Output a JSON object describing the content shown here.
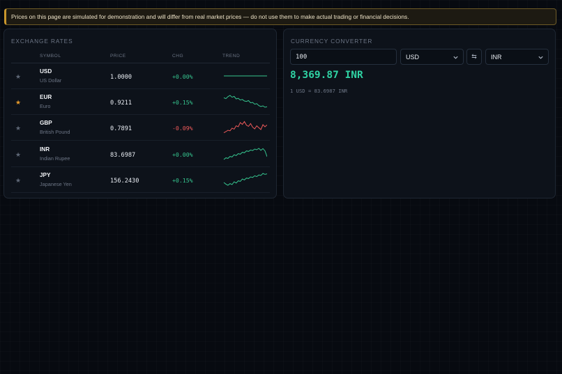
{
  "banner": {
    "text": "Prices on this page are simulated for demonstration and will differ from real market prices — do not use them to make actual trading or financial decisions."
  },
  "rates": {
    "title": "EXCHANGE RATES",
    "headers": {
      "symbol": "SYMBOL",
      "price": "PRICE",
      "chg": "CHG",
      "trend": "TREND"
    },
    "rows": [
      {
        "symbol": "USD",
        "name": "US Dollar",
        "price": "1.0000",
        "chg": "+0.00%",
        "dir": "up",
        "favorite": false,
        "trend": [
          0.5,
          0.5,
          0.5,
          0.5,
          0.5,
          0.5,
          0.5,
          0.5,
          0.5,
          0.5,
          0.5,
          0.5,
          0.5,
          0.5,
          0.5,
          0.5,
          0.5,
          0.5,
          0.5,
          0.5
        ]
      },
      {
        "symbol": "EUR",
        "name": "Euro",
        "price": "0.9211",
        "chg": "+0.15%",
        "dir": "up",
        "favorite": true,
        "trend": [
          0.78,
          0.72,
          0.86,
          0.95,
          0.82,
          0.88,
          0.7,
          0.74,
          0.62,
          0.66,
          0.55,
          0.52,
          0.58,
          0.42,
          0.45,
          0.32,
          0.36,
          0.22,
          0.15,
          0.2,
          0.1,
          0.14
        ]
      },
      {
        "symbol": "GBP",
        "name": "British Pound",
        "price": "0.7891",
        "chg": "-0.09%",
        "dir": "down",
        "favorite": false,
        "trend": [
          0.12,
          0.2,
          0.3,
          0.26,
          0.45,
          0.38,
          0.62,
          0.55,
          0.85,
          0.72,
          0.92,
          0.66,
          0.58,
          0.78,
          0.52,
          0.4,
          0.62,
          0.48,
          0.35,
          0.7,
          0.55,
          0.68
        ]
      },
      {
        "symbol": "INR",
        "name": "Indian Rupee",
        "price": "83.6987",
        "chg": "+0.00%",
        "dir": "up",
        "favorite": false,
        "trend": [
          0.1,
          0.22,
          0.18,
          0.32,
          0.28,
          0.44,
          0.38,
          0.52,
          0.48,
          0.62,
          0.58,
          0.72,
          0.68,
          0.78,
          0.74,
          0.85,
          0.8,
          0.9,
          0.76,
          0.88,
          0.72,
          0.3
        ]
      },
      {
        "symbol": "JPY",
        "name": "Japanese Yen",
        "price": "156.2430",
        "chg": "+0.15%",
        "dir": "up",
        "favorite": false,
        "trend": [
          0.3,
          0.18,
          0.1,
          0.22,
          0.15,
          0.35,
          0.26,
          0.42,
          0.38,
          0.55,
          0.48,
          0.62,
          0.58,
          0.7,
          0.66,
          0.78,
          0.72,
          0.84,
          0.8,
          0.95,
          0.88,
          0.92
        ]
      }
    ]
  },
  "converter": {
    "title": "CURRENCY CONVERTER",
    "amount": "100",
    "from": "USD",
    "to": "INR",
    "swap_icon": "⇆",
    "result": "8,369.87 INR",
    "ratio": "1 USD = 83.6987 INR"
  },
  "colors": {
    "up": "#36c58f",
    "down": "#ee5a5a",
    "star_fav": "#e79b2b",
    "accent": "#2fd3a4"
  }
}
